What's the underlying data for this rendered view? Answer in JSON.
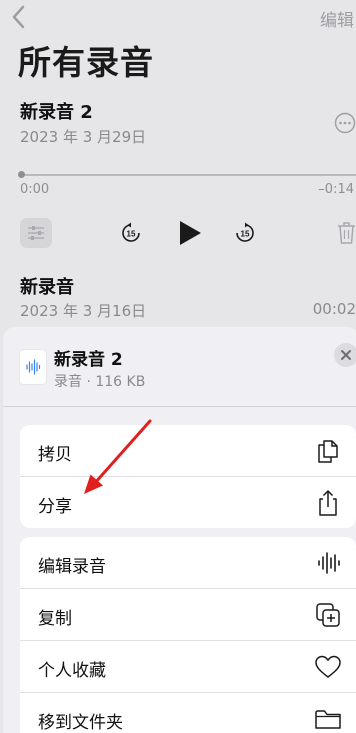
{
  "header": {
    "edit_label": "编辑",
    "title": "所有录音"
  },
  "recordings": [
    {
      "title": "新录音 2",
      "date": "2023 年 3 月29日"
    },
    {
      "title": "新录音",
      "date": "2023 年 3 月16日",
      "duration": "00:02"
    }
  ],
  "player": {
    "elapsed": "0:00",
    "remaining": "–0:14",
    "progress": 0.0
  },
  "share_sheet": {
    "file_name": "新录音 2",
    "file_meta": "录音 · 116 KB",
    "group1": [
      {
        "label": "拷贝",
        "icon": "copy-icon"
      },
      {
        "label": "分享",
        "icon": "share-icon"
      }
    ],
    "group2": [
      {
        "label": "编辑录音",
        "icon": "waveform-icon"
      },
      {
        "label": "复制",
        "icon": "duplicate-icon"
      },
      {
        "label": "个人收藏",
        "icon": "heart-icon"
      },
      {
        "label": "移到文件夹",
        "icon": "folder-icon"
      }
    ]
  },
  "colors": {
    "annotation_arrow": "#e02020",
    "sheet_bg": "#efeff4",
    "row_bg": "#ffffff"
  }
}
